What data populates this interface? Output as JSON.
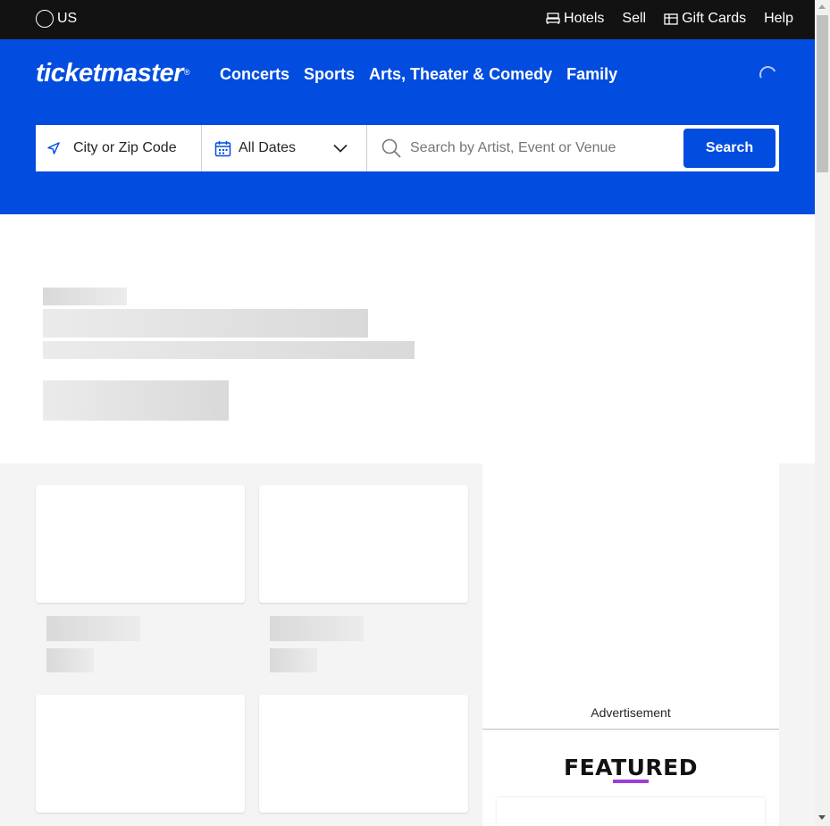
{
  "topbar": {
    "region": "US",
    "links": {
      "hotels": "Hotels",
      "sell": "Sell",
      "gift_cards": "Gift Cards",
      "help": "Help"
    }
  },
  "header": {
    "logo": "ticketmaster",
    "logo_mark": "®",
    "nav": [
      "Concerts",
      "Sports",
      "Arts, Theater & Comedy",
      "Family"
    ]
  },
  "search": {
    "city_label": "City or Zip Code",
    "dates_label": "All Dates",
    "query_placeholder": "Search by Artist, Event or Venue",
    "button_label": "Search"
  },
  "sidebar": {
    "ad_label": "Advertisement",
    "featured_title": "FEATURED"
  },
  "colors": {
    "brand_blue": "#024ddf",
    "topbar_black": "#121212",
    "featured_accent": "#9e3dd6",
    "content_gray": "#f4f4f4"
  }
}
